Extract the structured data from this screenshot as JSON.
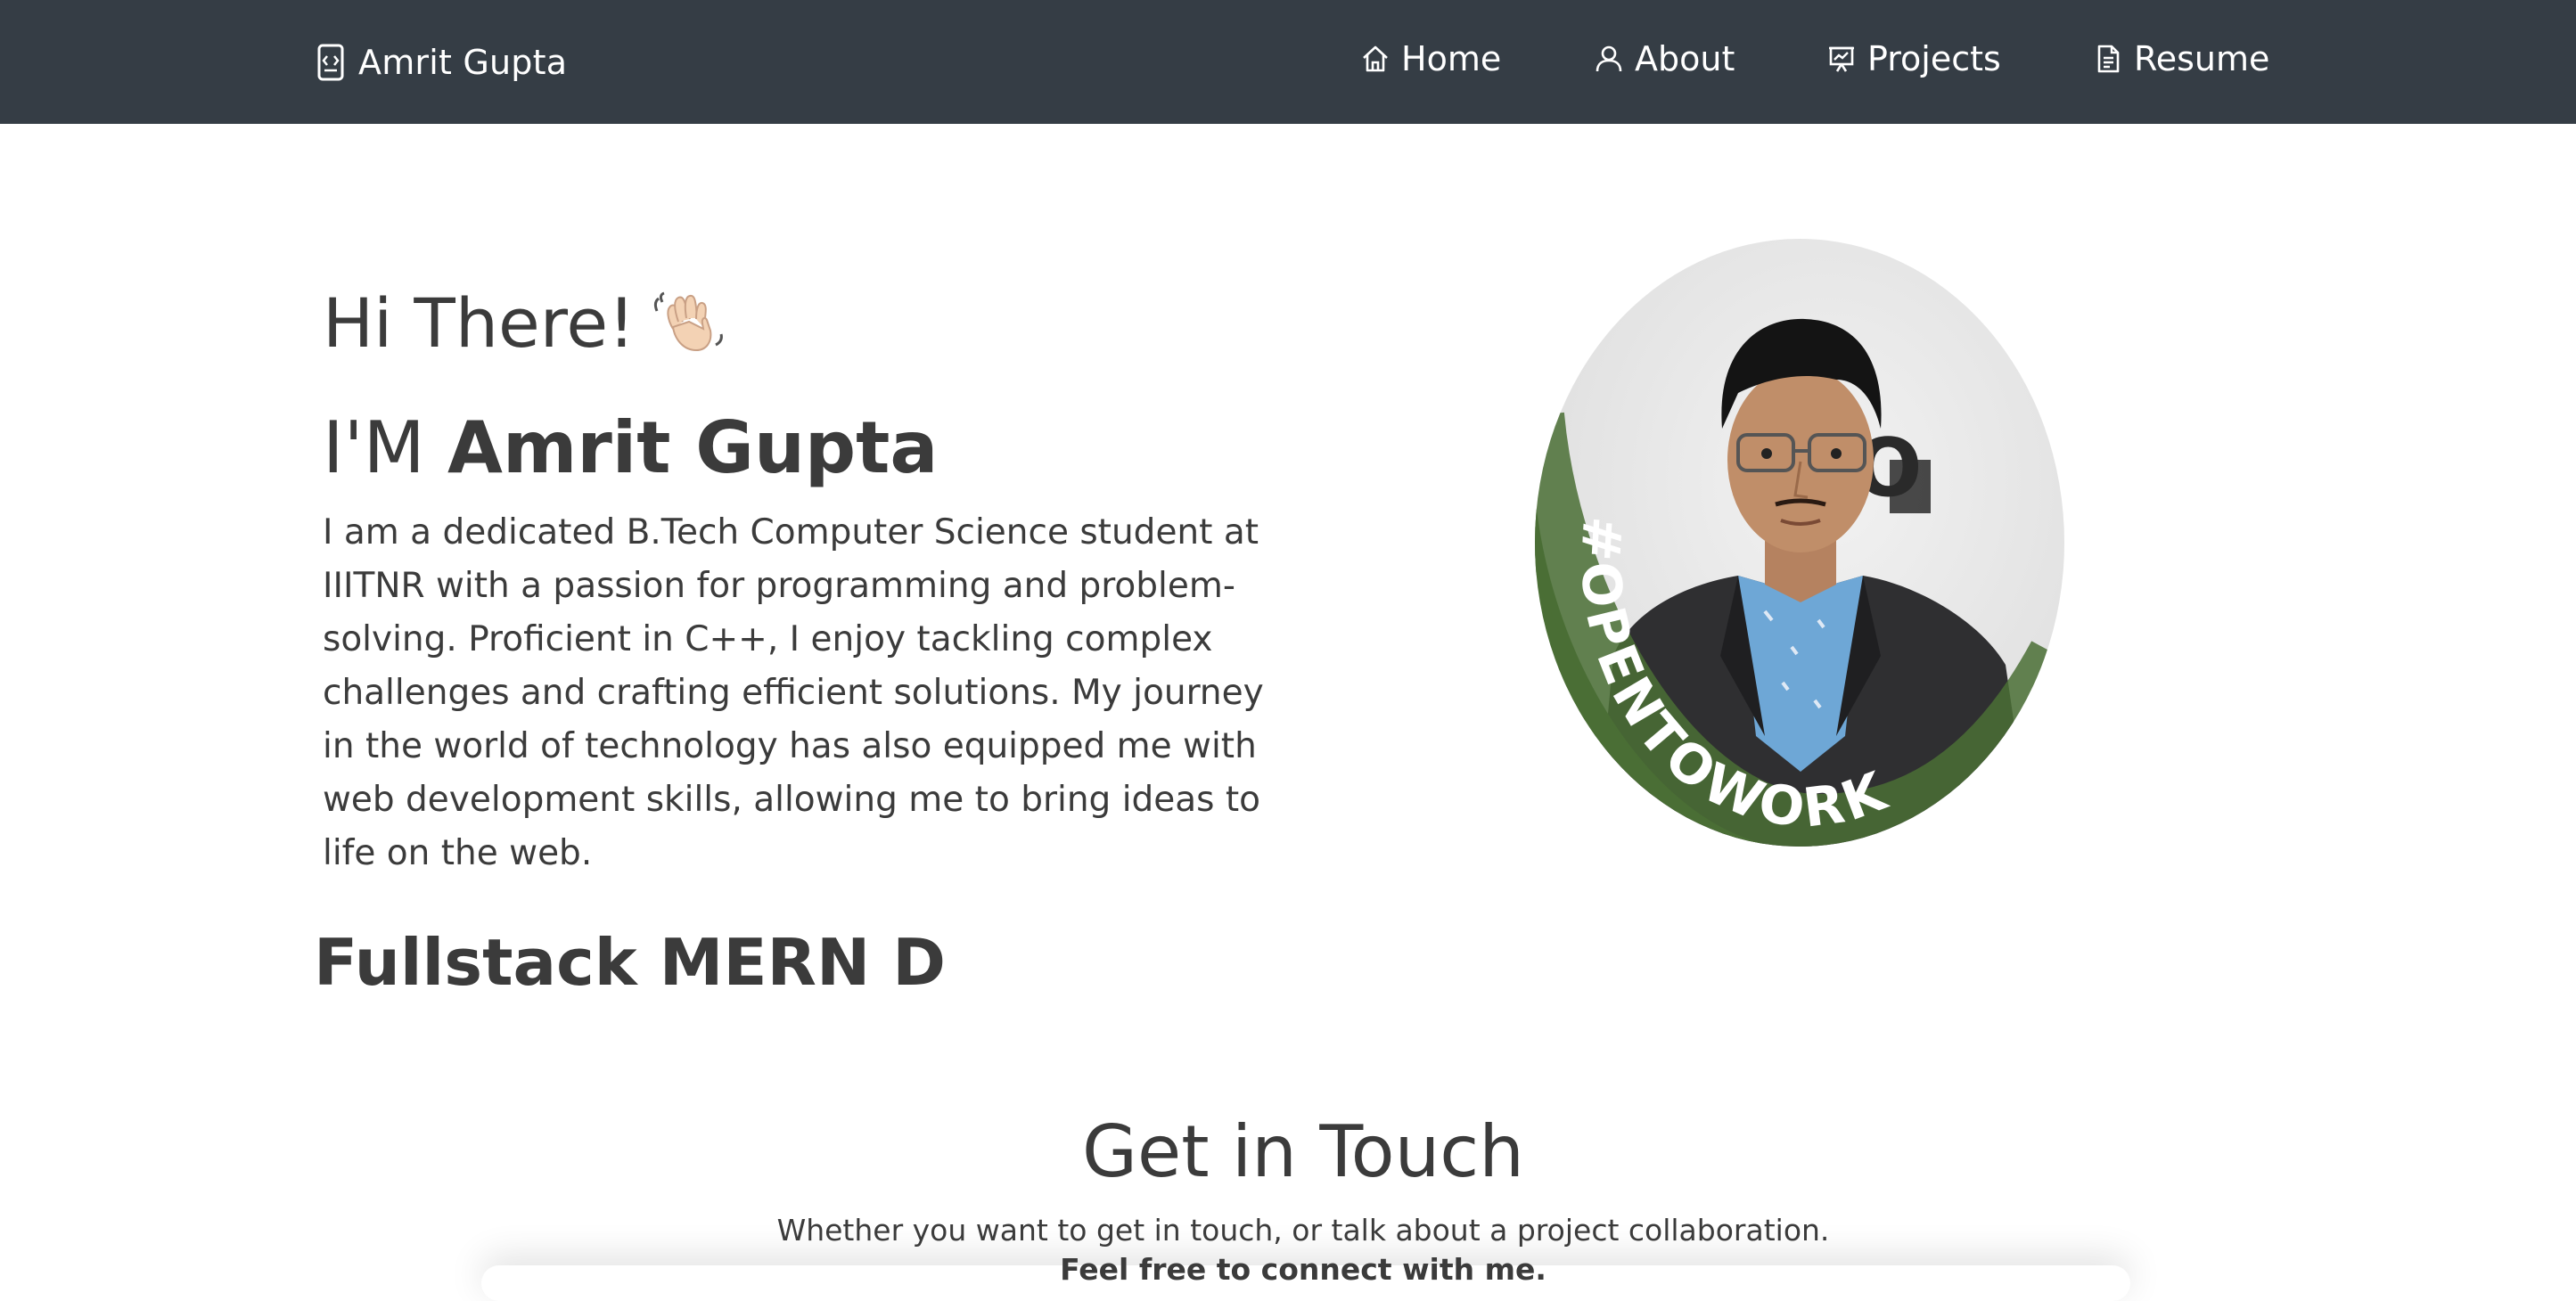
{
  "navbar": {
    "brand": "Amrit Gupta",
    "items": [
      {
        "label": "Home",
        "icon": "home-icon"
      },
      {
        "label": "About",
        "icon": "user-icon"
      },
      {
        "label": "Projects",
        "icon": "presentation-icon"
      },
      {
        "label": "Resume",
        "icon": "document-icon"
      }
    ],
    "background": "#353d45"
  },
  "hero": {
    "greeting": "Hi There!",
    "greeting_emoji": "waving-hand",
    "intro_prefix": "I'M",
    "name": "Amrit Gupta",
    "bio": "I am a dedicated B.Tech Computer Science student at IIITNR with a passion for programming and problem-solving. Proficient in C++, I enjoy tackling complex challenges and crafting efficient solutions. My journey in the world of technology has also equipped me with web development skills, allowing me to bring ideas to life on the web.",
    "typewriter_text": "Fullstack MERN D"
  },
  "avatar": {
    "badge_text": "#OPENTOWORK",
    "badge_color": "#4a6e35"
  },
  "contact": {
    "title": "Get in Touch",
    "subtitle": "Whether you want to get in touch, or talk about a project collaboration.",
    "subtitle2": "Feel free to connect with me."
  }
}
